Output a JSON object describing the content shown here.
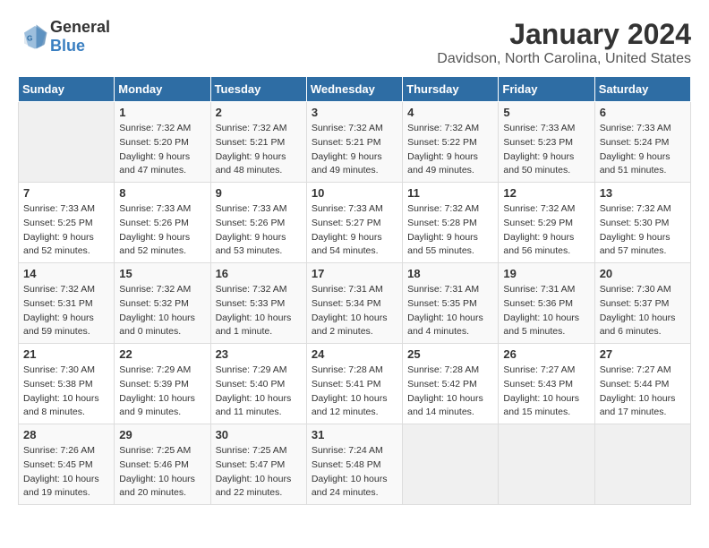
{
  "logo": {
    "general": "General",
    "blue": "Blue"
  },
  "title": {
    "month": "January 2024",
    "location": "Davidson, North Carolina, United States"
  },
  "weekdays": [
    "Sunday",
    "Monday",
    "Tuesday",
    "Wednesday",
    "Thursday",
    "Friday",
    "Saturday"
  ],
  "weeks": [
    [
      {
        "day": "",
        "info": ""
      },
      {
        "day": "1",
        "info": "Sunrise: 7:32 AM\nSunset: 5:20 PM\nDaylight: 9 hours\nand 47 minutes."
      },
      {
        "day": "2",
        "info": "Sunrise: 7:32 AM\nSunset: 5:21 PM\nDaylight: 9 hours\nand 48 minutes."
      },
      {
        "day": "3",
        "info": "Sunrise: 7:32 AM\nSunset: 5:21 PM\nDaylight: 9 hours\nand 49 minutes."
      },
      {
        "day": "4",
        "info": "Sunrise: 7:32 AM\nSunset: 5:22 PM\nDaylight: 9 hours\nand 49 minutes."
      },
      {
        "day": "5",
        "info": "Sunrise: 7:33 AM\nSunset: 5:23 PM\nDaylight: 9 hours\nand 50 minutes."
      },
      {
        "day": "6",
        "info": "Sunrise: 7:33 AM\nSunset: 5:24 PM\nDaylight: 9 hours\nand 51 minutes."
      }
    ],
    [
      {
        "day": "7",
        "info": "Sunrise: 7:33 AM\nSunset: 5:25 PM\nDaylight: 9 hours\nand 52 minutes."
      },
      {
        "day": "8",
        "info": "Sunrise: 7:33 AM\nSunset: 5:26 PM\nDaylight: 9 hours\nand 52 minutes."
      },
      {
        "day": "9",
        "info": "Sunrise: 7:33 AM\nSunset: 5:26 PM\nDaylight: 9 hours\nand 53 minutes."
      },
      {
        "day": "10",
        "info": "Sunrise: 7:33 AM\nSunset: 5:27 PM\nDaylight: 9 hours\nand 54 minutes."
      },
      {
        "day": "11",
        "info": "Sunrise: 7:32 AM\nSunset: 5:28 PM\nDaylight: 9 hours\nand 55 minutes."
      },
      {
        "day": "12",
        "info": "Sunrise: 7:32 AM\nSunset: 5:29 PM\nDaylight: 9 hours\nand 56 minutes."
      },
      {
        "day": "13",
        "info": "Sunrise: 7:32 AM\nSunset: 5:30 PM\nDaylight: 9 hours\nand 57 minutes."
      }
    ],
    [
      {
        "day": "14",
        "info": "Sunrise: 7:32 AM\nSunset: 5:31 PM\nDaylight: 9 hours\nand 59 minutes."
      },
      {
        "day": "15",
        "info": "Sunrise: 7:32 AM\nSunset: 5:32 PM\nDaylight: 10 hours\nand 0 minutes."
      },
      {
        "day": "16",
        "info": "Sunrise: 7:32 AM\nSunset: 5:33 PM\nDaylight: 10 hours\nand 1 minute."
      },
      {
        "day": "17",
        "info": "Sunrise: 7:31 AM\nSunset: 5:34 PM\nDaylight: 10 hours\nand 2 minutes."
      },
      {
        "day": "18",
        "info": "Sunrise: 7:31 AM\nSunset: 5:35 PM\nDaylight: 10 hours\nand 4 minutes."
      },
      {
        "day": "19",
        "info": "Sunrise: 7:31 AM\nSunset: 5:36 PM\nDaylight: 10 hours\nand 5 minutes."
      },
      {
        "day": "20",
        "info": "Sunrise: 7:30 AM\nSunset: 5:37 PM\nDaylight: 10 hours\nand 6 minutes."
      }
    ],
    [
      {
        "day": "21",
        "info": "Sunrise: 7:30 AM\nSunset: 5:38 PM\nDaylight: 10 hours\nand 8 minutes."
      },
      {
        "day": "22",
        "info": "Sunrise: 7:29 AM\nSunset: 5:39 PM\nDaylight: 10 hours\nand 9 minutes."
      },
      {
        "day": "23",
        "info": "Sunrise: 7:29 AM\nSunset: 5:40 PM\nDaylight: 10 hours\nand 11 minutes."
      },
      {
        "day": "24",
        "info": "Sunrise: 7:28 AM\nSunset: 5:41 PM\nDaylight: 10 hours\nand 12 minutes."
      },
      {
        "day": "25",
        "info": "Sunrise: 7:28 AM\nSunset: 5:42 PM\nDaylight: 10 hours\nand 14 minutes."
      },
      {
        "day": "26",
        "info": "Sunrise: 7:27 AM\nSunset: 5:43 PM\nDaylight: 10 hours\nand 15 minutes."
      },
      {
        "day": "27",
        "info": "Sunrise: 7:27 AM\nSunset: 5:44 PM\nDaylight: 10 hours\nand 17 minutes."
      }
    ],
    [
      {
        "day": "28",
        "info": "Sunrise: 7:26 AM\nSunset: 5:45 PM\nDaylight: 10 hours\nand 19 minutes."
      },
      {
        "day": "29",
        "info": "Sunrise: 7:25 AM\nSunset: 5:46 PM\nDaylight: 10 hours\nand 20 minutes."
      },
      {
        "day": "30",
        "info": "Sunrise: 7:25 AM\nSunset: 5:47 PM\nDaylight: 10 hours\nand 22 minutes."
      },
      {
        "day": "31",
        "info": "Sunrise: 7:24 AM\nSunset: 5:48 PM\nDaylight: 10 hours\nand 24 minutes."
      },
      {
        "day": "",
        "info": ""
      },
      {
        "day": "",
        "info": ""
      },
      {
        "day": "",
        "info": ""
      }
    ]
  ]
}
